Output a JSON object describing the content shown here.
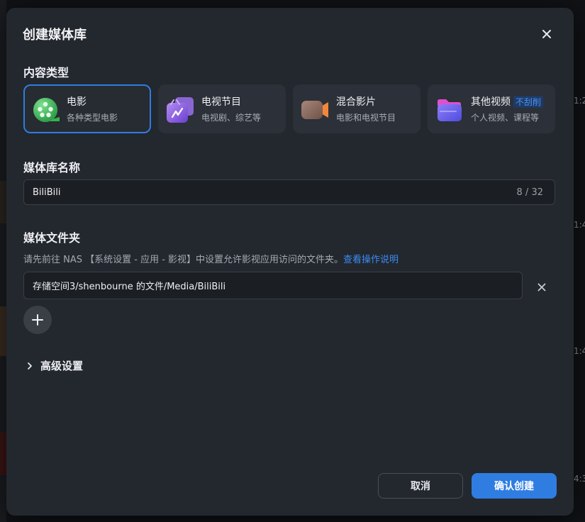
{
  "background": {
    "timestamps": [
      "1:2",
      "1:4",
      "1:4",
      "4:3"
    ]
  },
  "dialog": {
    "title": "创建媒体库",
    "close_icon": "close-icon"
  },
  "content_type": {
    "label": "内容类型",
    "options": [
      {
        "name": "电影",
        "desc": "各种类型电影",
        "icon": "film-reel-icon",
        "selected": true
      },
      {
        "name": "电视节目",
        "desc": "电视剧、综艺等",
        "icon": "tv-icon",
        "selected": false
      },
      {
        "name": "混合影片",
        "desc": "电影和电视节目",
        "icon": "video-camera-icon",
        "selected": false
      },
      {
        "name": "其他视频",
        "badge": "不刮削",
        "desc": "个人视频、课程等",
        "icon": "folder-icon",
        "selected": false
      }
    ]
  },
  "library_name": {
    "label": "媒体库名称",
    "value": "BiliBili",
    "counter": "8 / 32"
  },
  "media_folder": {
    "label": "媒体文件夹",
    "hint": "请先前往 NAS 【系统设置 - 应用 - 影视】中设置允许影视应用访问的文件夹。",
    "hint_link": "查看操作说明",
    "folders": [
      "存储空间3/shenbourne 的文件/Media/BiliBili"
    ]
  },
  "advanced": {
    "label": "高级设置"
  },
  "footer": {
    "cancel_label": "取消",
    "confirm_label": "确认创建"
  },
  "colors": {
    "accent": "#2f7de1",
    "dialog_bg": "#23272e",
    "card_bg": "#2c3038"
  }
}
